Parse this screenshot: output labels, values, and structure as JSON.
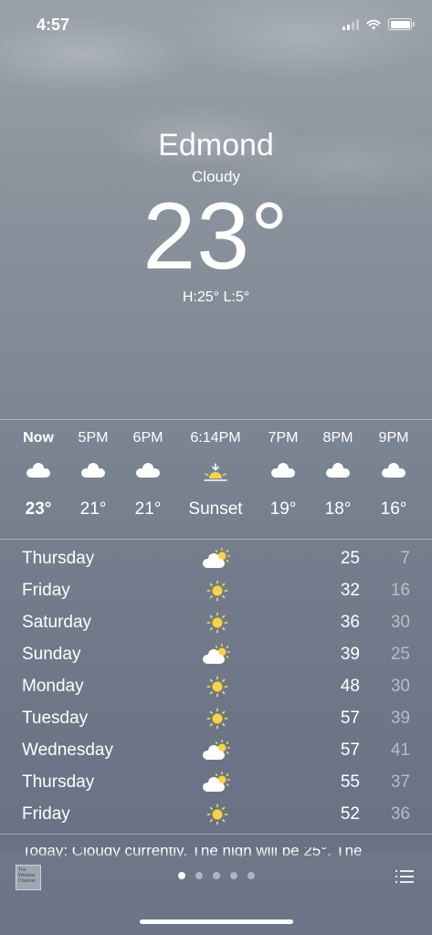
{
  "status_bar": {
    "time": "4:57"
  },
  "header": {
    "city": "Edmond",
    "condition": "Cloudy",
    "temperature": "23°",
    "hi_lo": "H:25°  L:5°"
  },
  "hourly": [
    {
      "label": "Now",
      "icon": "cloud-icon",
      "temp": "23°"
    },
    {
      "label": "5PM",
      "icon": "cloud-icon",
      "temp": "21°"
    },
    {
      "label": "6PM",
      "icon": "cloud-icon",
      "temp": "21°"
    },
    {
      "label": "6:14PM",
      "icon": "sunset-icon",
      "temp": "Sunset"
    },
    {
      "label": "7PM",
      "icon": "cloud-icon",
      "temp": "19°"
    },
    {
      "label": "8PM",
      "icon": "cloud-icon",
      "temp": "18°"
    },
    {
      "label": "9PM",
      "icon": "cloud-icon",
      "temp": "16°"
    }
  ],
  "daily": [
    {
      "day": "Thursday",
      "icon": "partly-cloudy-icon",
      "high": "25",
      "low": "7"
    },
    {
      "day": "Friday",
      "icon": "sun-icon",
      "high": "32",
      "low": "16"
    },
    {
      "day": "Saturday",
      "icon": "sun-icon",
      "high": "36",
      "low": "30"
    },
    {
      "day": "Sunday",
      "icon": "partly-cloudy-icon",
      "high": "39",
      "low": "25"
    },
    {
      "day": "Monday",
      "icon": "sun-icon",
      "high": "48",
      "low": "30"
    },
    {
      "day": "Tuesday",
      "icon": "sun-icon",
      "high": "57",
      "low": "39"
    },
    {
      "day": "Wednesday",
      "icon": "partly-cloudy-icon",
      "high": "57",
      "low": "41"
    },
    {
      "day": "Thursday",
      "icon": "partly-cloudy-icon",
      "high": "55",
      "low": "37"
    },
    {
      "day": "Friday",
      "icon": "sun-icon",
      "high": "52",
      "low": "36"
    }
  ],
  "summary": "Today: Cloudy currently. The high will be 25°. The",
  "bottom_bar": {
    "logo_text": "The Weather Channel",
    "page_count": 5,
    "active_page": 1
  },
  "colors": {
    "sun_yellow": "#f7d34a",
    "low_temp_text": "rgba(255,255,255,0.5)"
  }
}
